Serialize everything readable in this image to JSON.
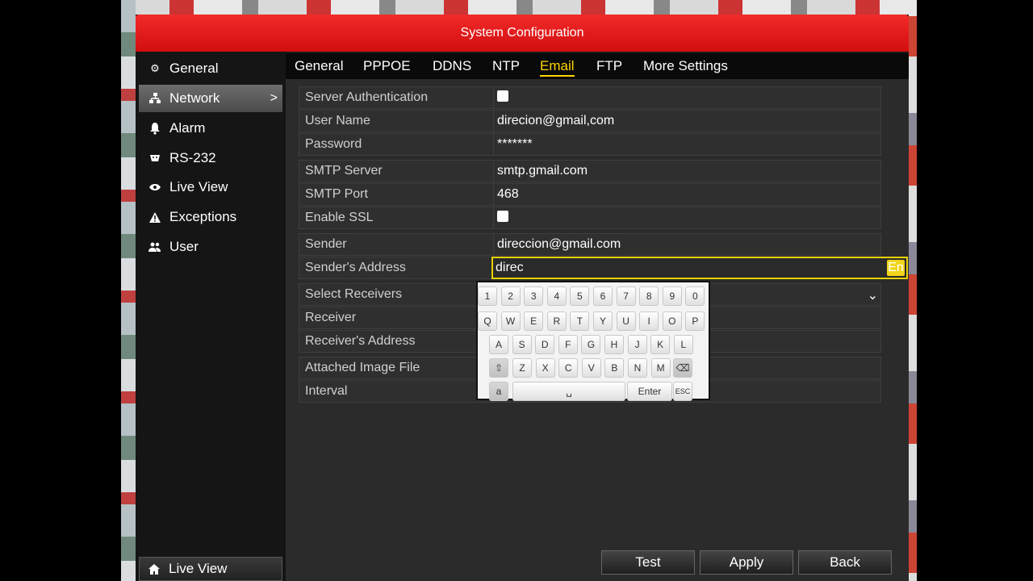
{
  "window": {
    "title": "System Configuration"
  },
  "sidebar": {
    "items": [
      {
        "label": "General",
        "icon": "gear-icon"
      },
      {
        "label": "Network",
        "icon": "network-icon",
        "chevron": ">"
      },
      {
        "label": "Alarm",
        "icon": "bell-icon"
      },
      {
        "label": "RS-232",
        "icon": "serial-port-icon"
      },
      {
        "label": "Live View",
        "icon": "eye-icon"
      },
      {
        "label": "Exceptions",
        "icon": "warning-icon"
      },
      {
        "label": "User",
        "icon": "users-icon"
      }
    ],
    "bottom_button": "Live View"
  },
  "tabs": [
    {
      "label": "General"
    },
    {
      "label": "PPPOE"
    },
    {
      "label": "DDNS"
    },
    {
      "label": "NTP"
    },
    {
      "label": "Email"
    },
    {
      "label": "FTP"
    },
    {
      "label": "More Settings"
    }
  ],
  "form": {
    "server_auth": {
      "label": "Server Authentication",
      "checked": "✔"
    },
    "user_name": {
      "label": "User Name",
      "value": "direcion@gmail,com"
    },
    "password": {
      "label": "Password",
      "value": "*******"
    },
    "smtp_server": {
      "label": "SMTP Server",
      "value": "smtp.gmail.com"
    },
    "smtp_port": {
      "label": "SMTP Port",
      "value": "468"
    },
    "enable_ssl": {
      "label": "Enable SSL",
      "checked": "✔"
    },
    "sender": {
      "label": "Sender",
      "value": "direccion@gmail.com"
    },
    "senders_address": {
      "label": "Sender's Address",
      "value": "direc",
      "lang": "En"
    },
    "select_receivers": {
      "label": "Select Receivers"
    },
    "receiver": {
      "label": "Receiver"
    },
    "receivers_address": {
      "label": "Receiver's Address"
    },
    "attached_image": {
      "label": "Attached Image File"
    },
    "interval": {
      "label": "Interval"
    }
  },
  "keyboard": {
    "row1": [
      "1",
      "2",
      "3",
      "4",
      "5",
      "6",
      "7",
      "8",
      "9",
      "0"
    ],
    "row2": [
      "Q",
      "W",
      "E",
      "R",
      "T",
      "Y",
      "U",
      "I",
      "O",
      "P"
    ],
    "row3": [
      "A",
      "S",
      "D",
      "F",
      "G",
      "H",
      "J",
      "K",
      "L"
    ],
    "row4": [
      "Z",
      "X",
      "C",
      "V",
      "B",
      "N",
      "M"
    ],
    "space": "␣",
    "enter": "Enter",
    "esc": "ESC",
    "shift": "⇧",
    "alt_mode": "a",
    "backspace": "⌫"
  },
  "buttons": {
    "test": "Test",
    "apply": "Apply",
    "back": "Back"
  },
  "colors": {
    "title_bar": "#e01818",
    "active_tab": "#ffd400",
    "focus_border": "#e8d200"
  }
}
